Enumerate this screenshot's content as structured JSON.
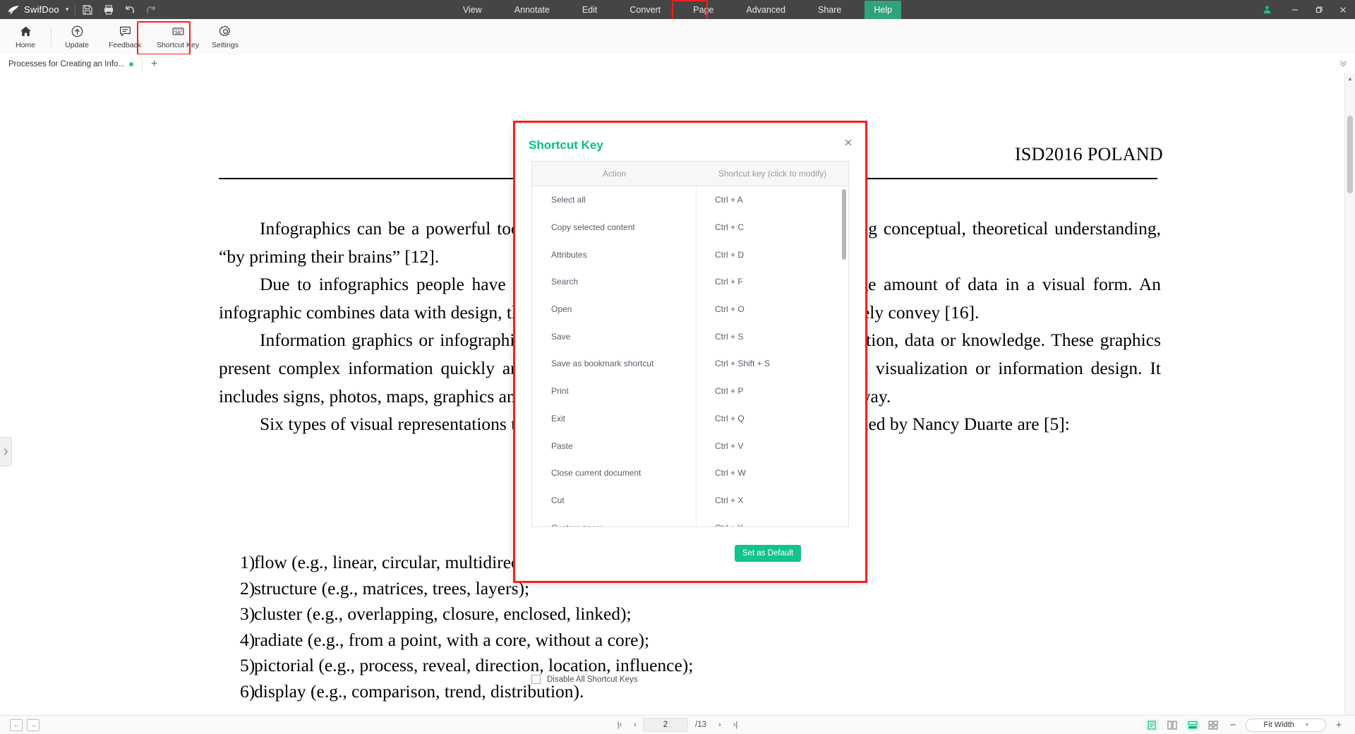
{
  "titlebar": {
    "brand": "SwifDoo",
    "caret": "▾",
    "icons": [
      {
        "name": "save-icon",
        "title": "Save"
      },
      {
        "name": "print-icon",
        "title": "Print"
      },
      {
        "name": "undo-icon",
        "title": "Undo"
      },
      {
        "name": "redo-icon",
        "title": "Redo"
      }
    ],
    "menus": [
      {
        "label": "View",
        "active": false
      },
      {
        "label": "Annotate",
        "active": false
      },
      {
        "label": "Edit",
        "active": false
      },
      {
        "label": "Convert",
        "active": false
      },
      {
        "label": "Page",
        "active": false
      },
      {
        "label": "Advanced",
        "active": false
      },
      {
        "label": "Share",
        "active": false
      },
      {
        "label": "Help",
        "active": true
      }
    ],
    "window_controls": [
      "minimize",
      "restore",
      "close"
    ],
    "account_icon": "user-icon",
    "highlight_color": "#ff1d1d",
    "active_menu_color": "#2fa37a"
  },
  "ribbon": {
    "items": [
      {
        "label": "Home",
        "icon": "home-icon"
      },
      {
        "label": "Update",
        "icon": "update-icon"
      },
      {
        "label": "Feedback",
        "icon": "feedback-icon"
      },
      {
        "label": "Shortcut Key",
        "icon": "keyboard-icon",
        "highlighted": true
      },
      {
        "label": "Settings",
        "icon": "gear-icon"
      }
    ]
  },
  "tabstrip": {
    "tabs": [
      {
        "label": "Processes for Creating an Info...",
        "modified": true
      }
    ],
    "add_label": "+"
  },
  "document": {
    "header": "ISD2016 POLAND",
    "paragraphs": [
      "Infographics can be a powerful tool for communicating information and supporting conceptual, theoretical understanding, “by priming their brains” [12].",
      "Due to infographics people have become used to the use of presentation of large amount of data in a visual form. An infographic combines data with design, thus helping individuals and organizations concisely convey [16].",
      "Information graphics or infographics are graphic visual representations of information, data or knowledge. These graphics present complex information quickly and clearly [11]. The infographic is part of data visualization or information design. It includes signs, photos, maps, graphics and charts, it presents this information in a visual way.",
      "Six types of visual representations that help communicate content to the reader defined by Nancy Duarte are [5]:"
    ],
    "list": [
      {
        "num": "1)",
        "text": "flow (e.g., linear, circular, multidirectional, bidirectional);"
      },
      {
        "num": "2)",
        "text": "structure (e.g., matrices, trees, layers);"
      },
      {
        "num": "3)",
        "text": "cluster (e.g., overlapping, closure, enclosed, linked);"
      },
      {
        "num": "4)",
        "text": "radiate (e.g., from a point, with a core, without a core);"
      },
      {
        "num": "5)",
        "text": "pictorial (e.g., process, reveal, direction, location, influence);"
      },
      {
        "num": "6)",
        "text": "display (e.g., comparison, trend, distribution)."
      }
    ]
  },
  "dialog": {
    "title": "Shortcut Key",
    "title_color": "#00c08a",
    "close_icon": "close-icon",
    "columns": [
      "Action",
      "Shortcut key (click to modify)"
    ],
    "rows": [
      {
        "action": "Select all",
        "key": "Ctrl + A"
      },
      {
        "action": "Copy selected content",
        "key": "Ctrl + C"
      },
      {
        "action": "Attributes",
        "key": "Ctrl + D"
      },
      {
        "action": "Search",
        "key": "Ctrl + F"
      },
      {
        "action": "Open",
        "key": "Ctrl + O"
      },
      {
        "action": "Save",
        "key": "Ctrl + S"
      },
      {
        "action": "Save as bookmark shortcut",
        "key": "Ctrl + Shift + S"
      },
      {
        "action": "Print",
        "key": "Ctrl + P"
      },
      {
        "action": "Exit",
        "key": "Ctrl + Q"
      },
      {
        "action": "Paste",
        "key": "Ctrl + V"
      },
      {
        "action": "Close current document",
        "key": "Ctrl + W"
      },
      {
        "action": "Cut",
        "key": "Ctrl + X"
      },
      {
        "action": "Custom zoom",
        "key": "Ctrl + Y"
      }
    ],
    "checkbox_label": "Disable All Shortcut Keys",
    "checkbox_checked": false,
    "button_label": "Set as Default",
    "button_color": "#14c28e"
  },
  "bottombar": {
    "left_icons": [
      "previous-view-icon",
      "next-view-icon"
    ],
    "page_current": "2",
    "page_total": "/13",
    "nav": {
      "first": "|‹",
      "prev": "‹",
      "next": "›",
      "last": "›|"
    },
    "view_modes": [
      {
        "name": "single-page-view",
        "selected": true
      },
      {
        "name": "two-page-view",
        "selected": false
      },
      {
        "name": "continuous-scroll-view",
        "selected": true
      },
      {
        "name": "thumbnail-grid-view",
        "selected": false
      }
    ],
    "zoom_minus": "−",
    "zoom_plus": "+",
    "zoom_value": "Fit Width",
    "zoom_caret": "▾"
  }
}
